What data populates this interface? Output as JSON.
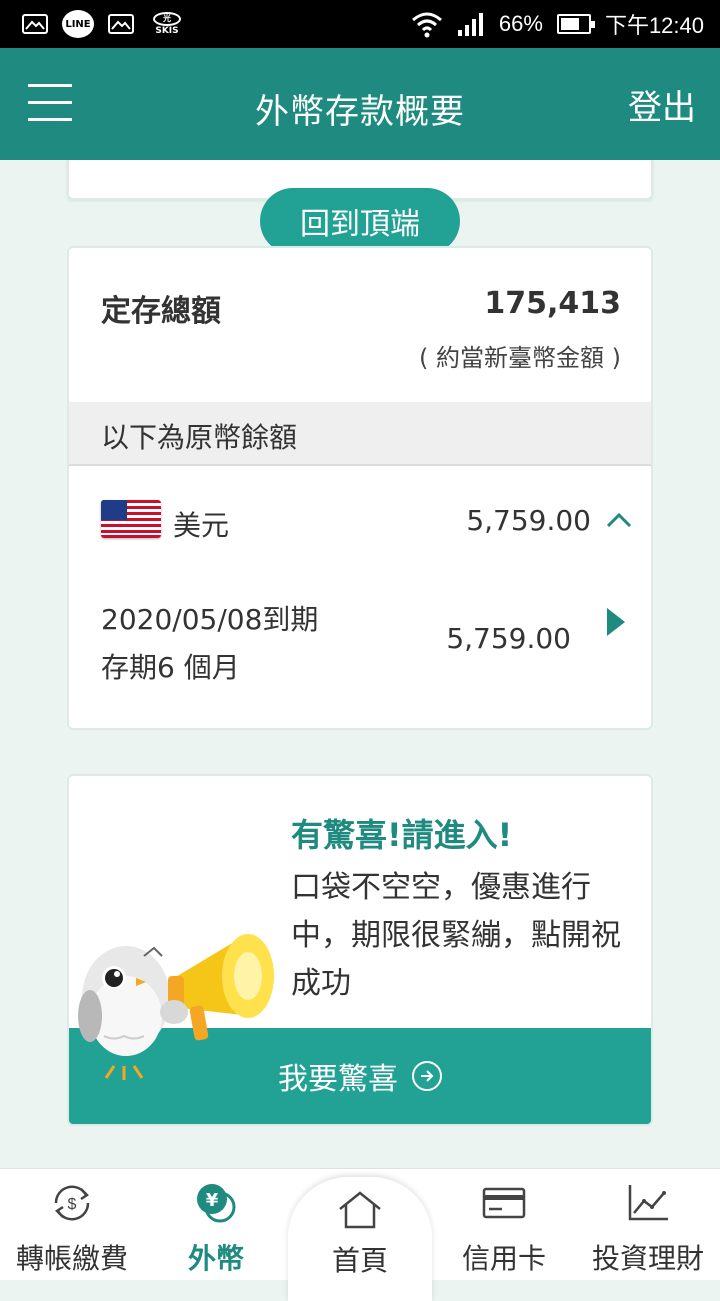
{
  "status_bar": {
    "battery": "66%",
    "time": "下午12:40",
    "line_label": "LINE",
    "skis_label": "SKIS"
  },
  "header": {
    "title": "外幣存款概要",
    "logout": "登出"
  },
  "back_to_top": "回到頂端",
  "deposit": {
    "total_label": "定存總額",
    "total_value": "175,413",
    "total_note": "( 約當新臺幣金額 )",
    "section_label": "以下為原幣餘額",
    "currency": {
      "name": "美元",
      "amount": "5,759.00"
    },
    "time_deposit": {
      "maturity": "2020/05/08到期",
      "term": "存期6 個月",
      "amount": "5,759.00"
    }
  },
  "promo": {
    "headline": "有驚喜!請進入!",
    "body": "口袋不空空，優惠進行中，期限很緊繃，點開祝成功",
    "button": "我要驚喜"
  },
  "bottom_nav": {
    "items": [
      {
        "label": "轉帳繳費",
        "icon": "transfer-icon"
      },
      {
        "label": "外幣",
        "icon": "forex-icon"
      },
      {
        "label": "首頁",
        "icon": "home-icon"
      },
      {
        "label": "信用卡",
        "icon": "credit-card-icon"
      },
      {
        "label": "投資理財",
        "icon": "investment-chart-icon"
      }
    ]
  },
  "colors": {
    "primary": "#1e8a80",
    "accent": "#22a195",
    "background": "#ecf4f2"
  }
}
